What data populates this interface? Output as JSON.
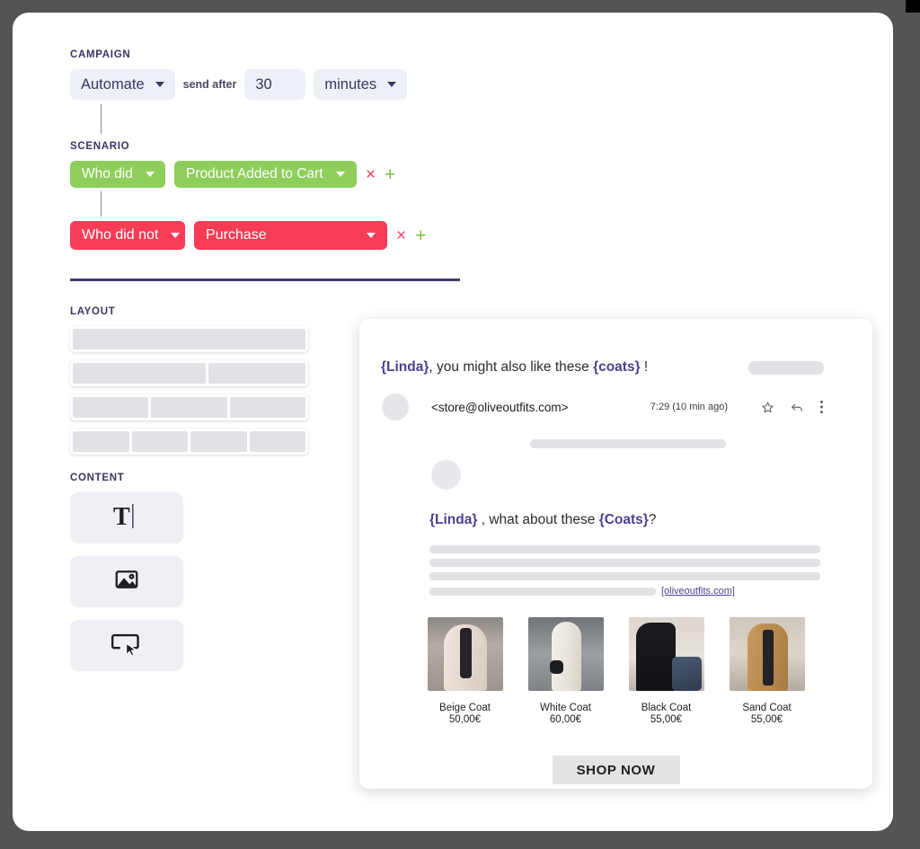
{
  "campaign": {
    "section_label": "CAMPAIGN",
    "trigger_type": "Automate",
    "send_after_label": "send after",
    "delay_value": "30",
    "delay_unit": "minutes"
  },
  "scenario": {
    "section_label": "SCENARIO",
    "rules": [
      {
        "condition": "Who did",
        "event": "Product Added to Cart",
        "remove_label": "×",
        "add_label": "+",
        "color": "#8ece5b"
      },
      {
        "condition": "Who did not",
        "event": "Purchase",
        "remove_label": "×",
        "add_label": "+",
        "color": "#f93c55"
      }
    ]
  },
  "layout": {
    "section_label": "LAYOUT",
    "options": [
      {
        "name": "one-column",
        "columns": [
          1
        ]
      },
      {
        "name": "two-column",
        "columns": [
          1.38,
          1
        ]
      },
      {
        "name": "three-column",
        "columns": [
          1,
          1,
          1
        ]
      },
      {
        "name": "four-column",
        "columns": [
          1,
          1,
          1,
          1
        ]
      }
    ]
  },
  "content": {
    "section_label": "CONTENT",
    "blocks": [
      {
        "name": "text-block",
        "icon": "text-icon"
      },
      {
        "name": "image-block",
        "icon": "image-icon"
      },
      {
        "name": "button-block",
        "icon": "button-icon"
      }
    ]
  },
  "email_preview": {
    "subject": {
      "parts": [
        {
          "text": "{Linda}",
          "token": true
        },
        {
          "text": ", you might also like these ",
          "token": false
        },
        {
          "text": "{coats}",
          "token": true
        },
        {
          "text": " !",
          "token": false
        }
      ]
    },
    "sender": "<store@oliveoutfits.com>",
    "timestamp": "7:29 (10 min ago)",
    "actions": [
      "star-icon",
      "reply-icon",
      "more-icon"
    ],
    "body_heading": {
      "parts": [
        {
          "text": "{Linda}",
          "token": true
        },
        {
          "text": " , what about these ",
          "token": false
        },
        {
          "text": "{Coats}",
          "token": true
        },
        {
          "text": "?",
          "token": false
        }
      ]
    },
    "site_link": "[oliveoutfits.com]",
    "products": [
      {
        "name": "Beige Coat",
        "price": "50,00€",
        "img": "img-beige"
      },
      {
        "name": "White Coat",
        "price": "60,00€",
        "img": "img-white"
      },
      {
        "name": "Black Coat",
        "price": "55,00€",
        "img": "img-black"
      },
      {
        "name": "Sand Coat",
        "price": "55,00€",
        "img": "img-sand"
      }
    ],
    "cta_label": "SHOP NOW"
  },
  "colors": {
    "accent_purple": "#4b3f93",
    "label_navy": "#3b3663",
    "green": "#8ece5b",
    "red": "#f93c55",
    "chip_bg": "#eef0f7",
    "page_bg": "#555455"
  }
}
